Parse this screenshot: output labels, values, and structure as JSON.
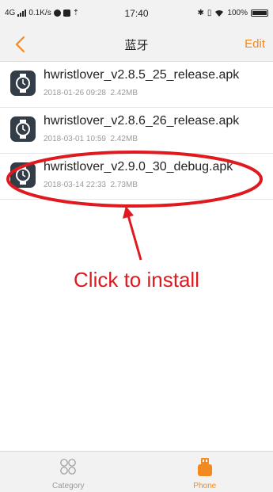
{
  "status_bar": {
    "network": "4G",
    "speed": "0.1K/s",
    "time": "17:40",
    "battery": "100%"
  },
  "nav": {
    "title": "蓝牙",
    "edit_label": "Edit"
  },
  "files": [
    {
      "name": "hwristlover_v2.8.5_25_release.apk",
      "date": "2018-01-26 09:28",
      "size": "2.42MB",
      "icon": "watch-app-icon"
    },
    {
      "name": "hwristlover_v2.8.6_26_release.apk",
      "date": "2018-03-01 10:59",
      "size": "2.42MB",
      "icon": "watch-app-icon"
    },
    {
      "name": "hwristlover_v2.9.0_30_debug.apk",
      "date": "2018-03-14 22:33",
      "size": "2.73MB",
      "icon": "watch-app-icon"
    }
  ],
  "annotation": {
    "text": "Click to install",
    "color": "#e0191f"
  },
  "tabs": [
    {
      "label": "Category",
      "icon": "category-icon",
      "active": false
    },
    {
      "label": "Phone",
      "icon": "phone-icon",
      "active": true
    }
  ],
  "colors": {
    "accent": "#f38a20",
    "annotation": "#e0191f"
  }
}
